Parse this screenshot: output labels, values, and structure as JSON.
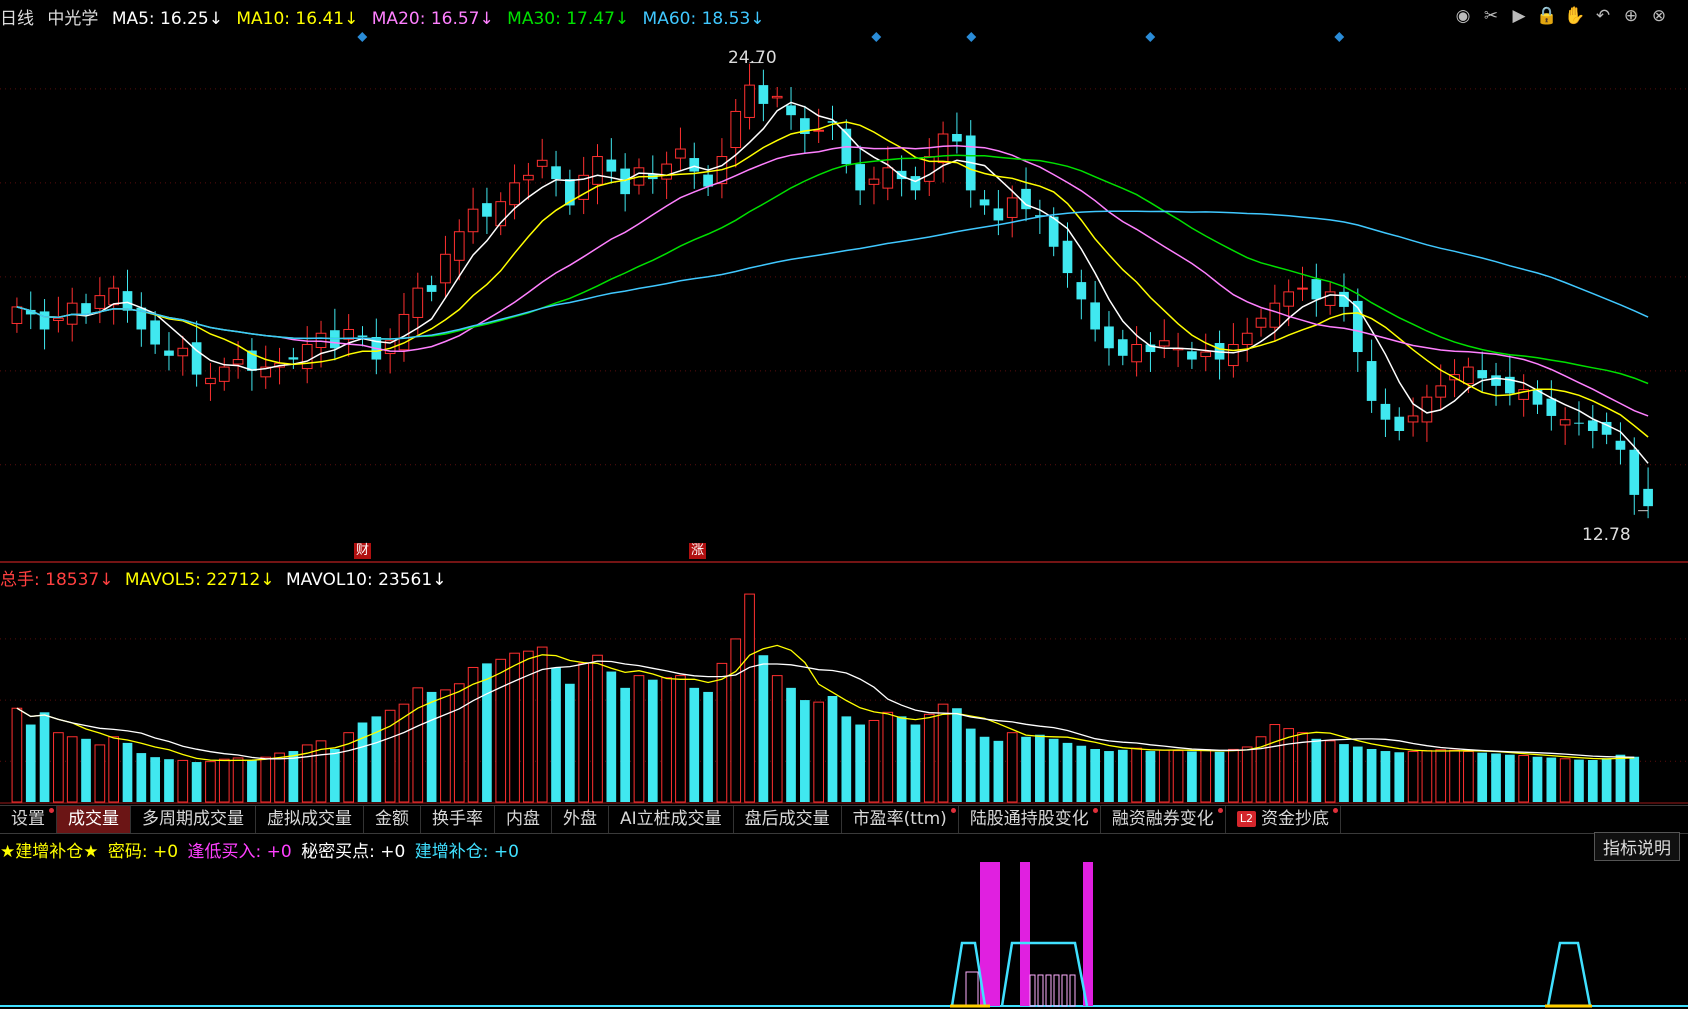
{
  "header": {
    "period": "日线",
    "stock_name": "中光学",
    "ma": [
      {
        "label": "MA5: 16.25↓",
        "color": "#ffffff"
      },
      {
        "label": "MA10: 16.41↓",
        "color": "#ffff00"
      },
      {
        "label": "MA20: 16.57↓",
        "color": "#ff80ff"
      },
      {
        "label": "MA30: 17.47↓",
        "color": "#00e000"
      },
      {
        "label": "MA60: 18.53↓",
        "color": "#40c8ff"
      }
    ]
  },
  "toolbar": {
    "icons": [
      "eye-icon",
      "scissors-icon",
      "play-icon",
      "lock-icon",
      "hand-icon",
      "undo-icon",
      "zoom-in-icon",
      "close-icon"
    ],
    "glyphs": [
      "◉",
      "✂",
      "▶",
      "🔒",
      "✋",
      "↶",
      "⊕",
      "⊗"
    ]
  },
  "price_panel": {
    "high_label": "24.70",
    "low_label": "12.78",
    "marker_cai": "财",
    "marker_zhang": "涨"
  },
  "volume_panel": {
    "total": "总手: 18537↓",
    "mavol5": "MAVOL5: 22712↓",
    "mavol10": "MAVOL10: 23561↓"
  },
  "tabs": [
    {
      "label": "设置",
      "dot": true
    },
    {
      "label": "成交量",
      "dot": false,
      "active": true
    },
    {
      "label": "多周期成交量",
      "dot": false
    },
    {
      "label": "虚拟成交量",
      "dot": false
    },
    {
      "label": "金额",
      "dot": false
    },
    {
      "label": "换手率",
      "dot": false
    },
    {
      "label": "内盘",
      "dot": false
    },
    {
      "label": "外盘",
      "dot": false
    },
    {
      "label": "AI立桩成交量",
      "dot": false
    },
    {
      "label": "盘后成交量",
      "dot": false
    },
    {
      "label": "市盈率(ttm)",
      "dot": true
    },
    {
      "label": "陆股通持股变化",
      "dot": true
    },
    {
      "label": "融资融券变化",
      "dot": true
    },
    {
      "label": "资金抄底",
      "dot": true,
      "badge": "L2"
    }
  ],
  "indicator": {
    "name": "★建增补仓★",
    "items": [
      {
        "label": "密码: +0",
        "color": "#ffff00"
      },
      {
        "label": "逢低买入: +0",
        "color": "#ff40ff"
      },
      {
        "label": "秘密买点: +0",
        "color": "#ffffff"
      },
      {
        "label": "建增补仓: +0",
        "color": "#40e0ff"
      }
    ],
    "help_label": "指标说明"
  },
  "colors": {
    "up": "#ff3030",
    "down": "#40e8f0",
    "panel_border": "#8b1010",
    "grid": "#8b1010"
  },
  "chart_data": {
    "type": "candlestick",
    "price_range": [
      12.78,
      24.7
    ],
    "high": 24.7,
    "low": 12.78,
    "ma_last": {
      "MA5": 16.25,
      "MA10": 16.41,
      "MA20": 16.57,
      "MA30": 17.47,
      "MA60": 18.53
    },
    "volume_last": {
      "total": 18537,
      "MAVOL5": 22712,
      "MAVOL10": 23561
    },
    "closes": [
      18.2,
      18.0,
      17.6,
      17.9,
      18.3,
      18.0,
      18.5,
      18.7,
      18.1,
      17.6,
      17.2,
      16.9,
      17.1,
      16.4,
      16.3,
      16.6,
      16.8,
      16.5,
      16.6,
      16.7,
      16.8,
      17.2,
      17.5,
      17.1,
      17.6,
      17.4,
      16.8,
      17.3,
      18.0,
      18.7,
      18.6,
      19.6,
      20.2,
      20.8,
      20.6,
      21.0,
      21.5,
      21.7,
      22.1,
      21.6,
      20.9,
      21.7,
      22.2,
      21.8,
      21.2,
      21.9,
      21.6,
      22.0,
      22.4,
      21.8,
      21.4,
      22.2,
      23.4,
      24.1,
      23.6,
      23.8,
      23.3,
      22.8,
      22.9,
      23.1,
      22.0,
      21.3,
      21.6,
      21.9,
      21.6,
      21.3,
      22.2,
      22.8,
      22.6,
      21.3,
      20.9,
      20.5,
      21.1,
      20.8,
      20.6,
      19.8,
      19.1,
      18.4,
      17.6,
      17.1,
      16.9,
      17.2,
      17.0,
      17.3,
      17.1,
      16.8,
      17.0,
      16.8,
      17.2,
      17.5,
      17.9,
      18.3,
      18.6,
      18.7,
      18.4,
      18.6,
      18.2,
      17.0,
      15.7,
      15.2,
      14.9,
      15.3,
      15.8,
      16.1,
      16.4,
      16.6,
      16.3,
      16.1,
      15.9,
      16.0,
      15.6,
      15.3,
      15.2,
      15.1,
      14.9,
      14.8,
      14.4,
      13.2,
      12.9
    ],
    "volumes": [
      23000,
      19000,
      22000,
      17000,
      16000,
      15500,
      14000,
      16000,
      14500,
      12000,
      11000,
      10500,
      10200,
      9800,
      9900,
      10500,
      10800,
      10300,
      11000,
      12000,
      12500,
      14000,
      15000,
      13000,
      17000,
      19500,
      21000,
      22500,
      24000,
      28000,
      27000,
      27500,
      29000,
      33000,
      34000,
      35000,
      36500,
      37000,
      38000,
      33000,
      29000,
      34000,
      36000,
      32000,
      28000,
      31000,
      30000,
      30500,
      31000,
      28000,
      27000,
      34000,
      40000,
      51000,
      36000,
      31000,
      28000,
      25000,
      24500,
      26000,
      21000,
      19000,
      20000,
      22000,
      21000,
      19000,
      21500,
      24000,
      23000,
      18000,
      16000,
      15000,
      17000,
      16000,
      16500,
      15500,
      14500,
      13800,
      13000,
      12500,
      12800,
      13200,
      12500,
      12700,
      12600,
      12400,
      12800,
      12300,
      12900,
      13500,
      16000,
      19000,
      18000,
      17000,
      15500,
      15000,
      14200,
      13600,
      13000,
      12500,
      12200,
      12400,
      12600,
      12800,
      12700,
      12400,
      12100,
      11900,
      11600,
      11400,
      11100,
      10900,
      10600,
      10400,
      10300,
      10700,
      11600,
      11100
    ]
  }
}
